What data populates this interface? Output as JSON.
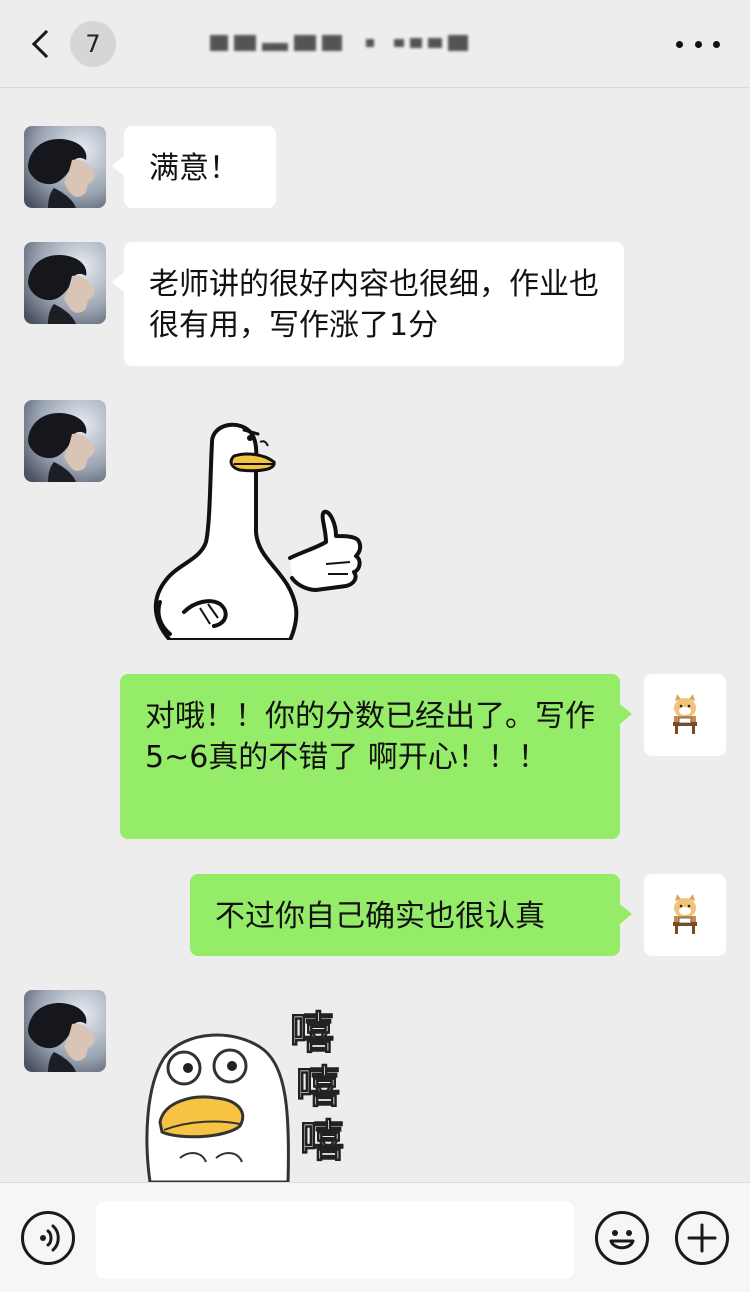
{
  "header": {
    "back_label": "<",
    "unread_count": "7",
    "title_redacted": true
  },
  "messages": [
    {
      "sender": "other",
      "type": "text",
      "text": "满意！"
    },
    {
      "sender": "other",
      "type": "text",
      "text": "老师讲的很好内容也很细，作业也很有用，写作涨了1分"
    },
    {
      "sender": "other",
      "type": "sticker",
      "sticker": "duck-thumbs-up"
    },
    {
      "sender": "me",
      "type": "text",
      "text": "对哦！！你的分数已经出了。写作5~6真的不错了 啊开心！！！"
    },
    {
      "sender": "me",
      "type": "text",
      "text": "不过你自己确实也很认真"
    },
    {
      "sender": "other",
      "type": "sticker",
      "sticker": "duck-laughing",
      "caption_chars": [
        "嘻",
        "嘻",
        "嘻"
      ]
    }
  ],
  "input_bar": {
    "voice_icon": "voice-icon",
    "emoji_icon": "emoji-icon",
    "plus_icon": "plus-icon",
    "input_value": ""
  },
  "colors": {
    "background": "#ededed",
    "incoming_bubble": "#ffffff",
    "outgoing_bubble": "#95ec69"
  }
}
